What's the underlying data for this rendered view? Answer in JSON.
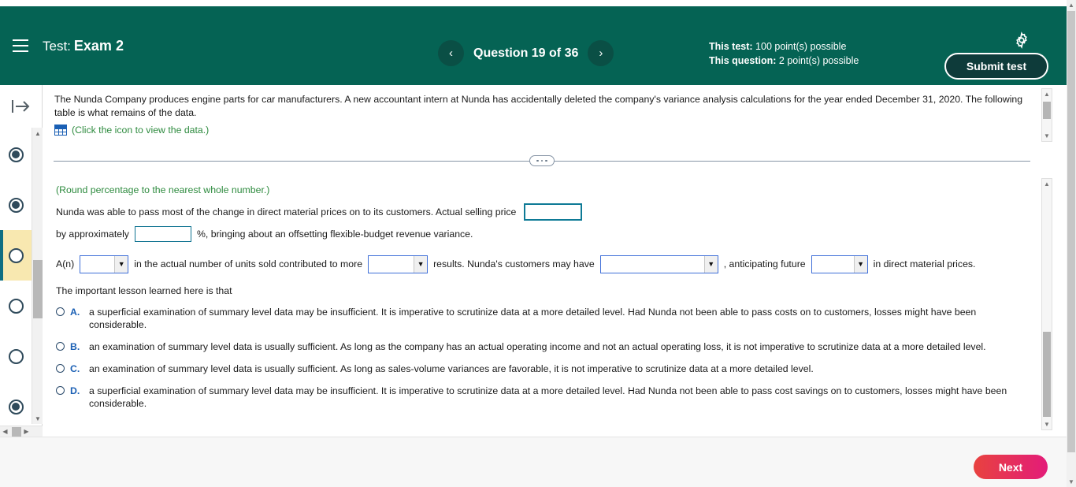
{
  "header": {
    "menu_icon": "hamburger-icon",
    "test_prefix": "Test:",
    "test_name": "Exam 2",
    "prev_icon": "chevron-left-icon",
    "next_icon": "chevron-right-icon",
    "question_counter": "Question 19 of 36",
    "points": {
      "test_label": "This test:",
      "test_value": "100 point(s) possible",
      "question_label": "This question:",
      "question_value": "2 point(s) possible"
    },
    "gear_icon": "gear-icon",
    "submit_label": "Submit test",
    "bg_color": "#056354"
  },
  "sidebar": {
    "collapse_icon": "expand-panel-arrow-icon",
    "items": [
      {
        "name": "question-dot-1",
        "state": "answered"
      },
      {
        "name": "question-dot-2",
        "state": "answered"
      },
      {
        "name": "question-dot-3",
        "state": "current"
      },
      {
        "name": "question-dot-4",
        "state": "unanswered"
      },
      {
        "name": "question-dot-5",
        "state": "unanswered"
      },
      {
        "name": "question-dot-6",
        "state": "answered"
      }
    ],
    "highlight_color": "#f8e8b0",
    "marker_color": "#0f6e82",
    "scroll_up_icon": "caret-up-icon",
    "scroll_down_icon": "caret-down-icon",
    "hscroll_left_icon": "caret-left-icon",
    "hscroll_right_icon": "caret-right-icon"
  },
  "problem": {
    "paragraph": "The Nunda Company produces engine parts for car manufacturers. A new accountant intern at Nunda has accidentally deleted the company's variance analysis calculations for the year ended December 31, 2020. The following table is what remains of the data.",
    "data_icon": "table-grid-icon",
    "data_link": "(Click the icon to view the data.)",
    "link_color": "#2e8b3f"
  },
  "divider": {
    "handle_icon": "drag-dots-handle"
  },
  "answer": {
    "round_note": "(Round percentage to the nearest whole number.)",
    "line1_text": "Nunda was able to pass most of the change in direct material prices on to its customers. Actual selling price",
    "line1_input_value": "",
    "line2_prefix": "by approximately",
    "line2_input_value": "",
    "line2_suffix": "%, bringing about an offsetting flexible-budget revenue variance.",
    "line3_a": "A(n)",
    "select1_value": "",
    "line3_b": "in the actual number of units sold contributed to more",
    "select2_value": "",
    "line3_c": "results. Nunda's customers may have",
    "select3_value": "",
    "line3_d": ", anticipating future",
    "select4_value": "",
    "line3_e": "in direct material prices.",
    "lesson_prompt": "The important lesson learned here is that",
    "choices": [
      {
        "letter": "A.",
        "text": "a superficial examination of summary level data may be insufficient. It is imperative to scrutinize data at a more detailed level. Had Nunda not been able to pass costs on to customers, losses might have been considerable.",
        "selected": false
      },
      {
        "letter": "B.",
        "text": "an examination of summary level data is usually sufficient. As long as the company has an actual operating income and not an actual operating loss, it is not imperative to scrutinize data at a more detailed level.",
        "selected": false
      },
      {
        "letter": "C.",
        "text": "an examination of summary level data is usually sufficient. As long as sales-volume variances are favorable, it is not imperative to scrutinize data at a more detailed level.",
        "selected": false
      },
      {
        "letter": "D.",
        "text": "a superficial examination of summary level data may be insufficient. It is imperative to scrutinize data at a more detailed level. Had Nunda not been able to pass cost savings on to customers, losses might have been considerable.",
        "selected": false
      }
    ]
  },
  "footer": {
    "next_label": "Next",
    "next_color_start": "#e8423f",
    "next_color_end": "#e31c79"
  },
  "scrollbars": {
    "up_icon": "caret-up-icon",
    "down_icon": "caret-down-icon"
  }
}
